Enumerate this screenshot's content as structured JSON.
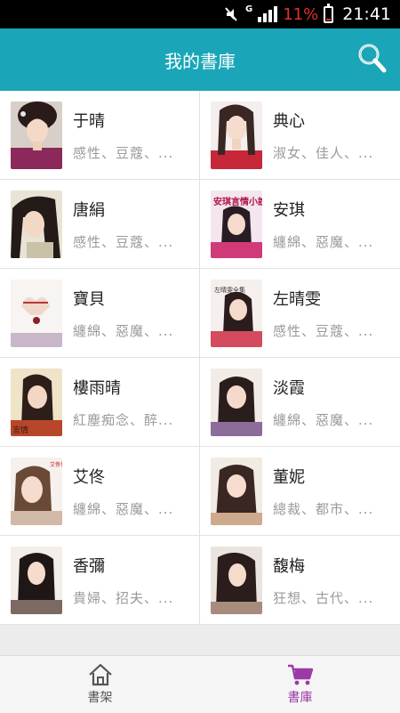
{
  "status_bar": {
    "network_type": "G",
    "battery_percent": "11%",
    "time": "21:41"
  },
  "header": {
    "title": "我的書庫",
    "search_icon": "search-icon"
  },
  "authors": [
    {
      "name": "于晴",
      "tags": "感性、豆蔻、..."
    },
    {
      "name": "典心",
      "tags": "淑女、佳人、..."
    },
    {
      "name": "唐絹",
      "tags": "感性、豆蔻、..."
    },
    {
      "name": "安琪",
      "tags": "纏綿、惡魔、...",
      "cover_text": "安琪言情小說全集"
    },
    {
      "name": "寶貝",
      "tags": "纏綿、惡魔、..."
    },
    {
      "name": "左晴雯",
      "tags": "感性、豆蔻、...",
      "cover_text": "左晴雯全集"
    },
    {
      "name": "樓雨晴",
      "tags": "紅塵痴念、醉...",
      "cover_text": "言情"
    },
    {
      "name": "淡霞",
      "tags": "纏綿、惡魔、..."
    },
    {
      "name": "艾佟",
      "tags": "纏綿、惡魔、...",
      "cover_text": "艾佟作品全集"
    },
    {
      "name": "董妮",
      "tags": "總裁、都市、..."
    },
    {
      "name": "香彌",
      "tags": "貴婦、招夫、..."
    },
    {
      "name": "馥梅",
      "tags": "狂想、古代、..."
    }
  ],
  "bottom_nav": {
    "bookshelf_label": "書架",
    "library_label": "書庫",
    "active_tab": "library"
  },
  "colors": {
    "header_bg": "#1aa6b8",
    "active_tab": "#9b3aa6",
    "battery_low": "#e0302a"
  }
}
